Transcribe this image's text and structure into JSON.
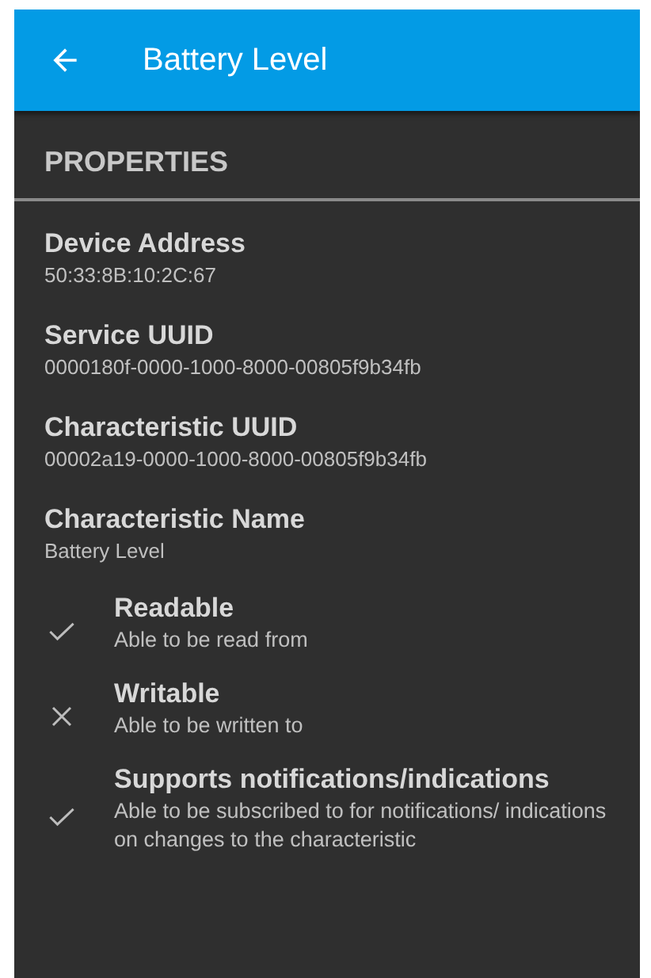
{
  "app_bar": {
    "title": "Battery Level"
  },
  "section": {
    "title": "PROPERTIES"
  },
  "fields": [
    {
      "label": "Device Address",
      "value": "50:33:8B:10:2C:67"
    },
    {
      "label": "Service UUID",
      "value": "0000180f-0000-1000-8000-00805f9b34fb"
    },
    {
      "label": "Characteristic UUID",
      "value": "00002a19-0000-1000-8000-00805f9b34fb"
    },
    {
      "label": "Characteristic Name",
      "value": "Battery Level"
    }
  ],
  "capabilities": [
    {
      "title": "Readable",
      "description": "Able to be read from",
      "supported": true
    },
    {
      "title": "Writable",
      "description": "Able to be written to",
      "supported": false
    },
    {
      "title": "Supports notifications/indications",
      "description": "Able to be subscribed to for notifications/ indications on changes to the characteristic",
      "supported": true
    }
  ]
}
